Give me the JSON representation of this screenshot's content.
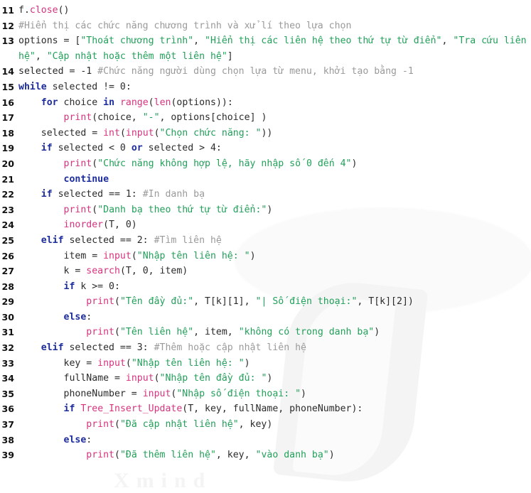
{
  "listing": {
    "language": "python",
    "first_line_number": 11,
    "last_line_number": 39,
    "colors": {
      "background": "#ffffff",
      "keyword": "#1c2c9c",
      "function": "#d6337f",
      "string": "#22a05a",
      "comment": "#9a9a9a",
      "plain": "#2b2b2b",
      "line_number": "#111111",
      "watermark": "#f2f2f2"
    },
    "lines": [
      {
        "number": "11",
        "tokens": [
          {
            "t": "plain",
            "v": "f."
          },
          {
            "t": "fn",
            "v": "close"
          },
          {
            "t": "plain",
            "v": "()"
          }
        ]
      },
      {
        "number": "12",
        "tokens": [
          {
            "t": "com",
            "v": "#Hiển thị các chức năng chương trình và xử lí theo lựa chọn"
          }
        ]
      },
      {
        "number": "13",
        "tokens": [
          {
            "t": "plain",
            "v": "options = ["
          },
          {
            "t": "str",
            "v": "\"Thoát chương trình\""
          },
          {
            "t": "plain",
            "v": ", "
          },
          {
            "t": "str",
            "v": "\"Hiển thị các liên hệ theo thứ tự từ điển\""
          },
          {
            "t": "plain",
            "v": ", "
          },
          {
            "t": "str",
            "v": "\"Tra cứu liên hệ\""
          },
          {
            "t": "plain",
            "v": ", "
          },
          {
            "t": "str",
            "v": "\"Cập nhật hoặc thêm một liên hệ\""
          },
          {
            "t": "plain",
            "v": "]"
          }
        ]
      },
      {
        "number": "14",
        "tokens": [
          {
            "t": "plain",
            "v": "selected = -1 "
          },
          {
            "t": "com",
            "v": "#Chức năng người dùng chọn lựa từ menu, khởi tạo bằng -1"
          }
        ]
      },
      {
        "number": "15",
        "tokens": [
          {
            "t": "kw",
            "v": "while"
          },
          {
            "t": "plain",
            "v": " selected != 0:"
          }
        ]
      },
      {
        "number": "16",
        "tokens": [
          {
            "t": "plain",
            "v": "    "
          },
          {
            "t": "kw",
            "v": "for"
          },
          {
            "t": "plain",
            "v": " choice "
          },
          {
            "t": "kw",
            "v": "in"
          },
          {
            "t": "plain",
            "v": " "
          },
          {
            "t": "fn",
            "v": "range"
          },
          {
            "t": "plain",
            "v": "("
          },
          {
            "t": "fn",
            "v": "len"
          },
          {
            "t": "plain",
            "v": "(options)):"
          }
        ]
      },
      {
        "number": "17",
        "tokens": [
          {
            "t": "plain",
            "v": "        "
          },
          {
            "t": "fn",
            "v": "print"
          },
          {
            "t": "plain",
            "v": "(choice, "
          },
          {
            "t": "str",
            "v": "\"-\""
          },
          {
            "t": "plain",
            "v": ", options[choice] )"
          }
        ]
      },
      {
        "number": "18",
        "tokens": [
          {
            "t": "plain",
            "v": "    selected = "
          },
          {
            "t": "fn",
            "v": "int"
          },
          {
            "t": "plain",
            "v": "("
          },
          {
            "t": "fn",
            "v": "input"
          },
          {
            "t": "plain",
            "v": "("
          },
          {
            "t": "str",
            "v": "\"Chọn chức năng: \""
          },
          {
            "t": "plain",
            "v": "))"
          }
        ]
      },
      {
        "number": "19",
        "tokens": [
          {
            "t": "plain",
            "v": "    "
          },
          {
            "t": "kw",
            "v": "if"
          },
          {
            "t": "plain",
            "v": " selected < 0 "
          },
          {
            "t": "kw",
            "v": "or"
          },
          {
            "t": "plain",
            "v": " selected > 4:"
          }
        ]
      },
      {
        "number": "20",
        "tokens": [
          {
            "t": "plain",
            "v": "        "
          },
          {
            "t": "fn",
            "v": "print"
          },
          {
            "t": "plain",
            "v": "("
          },
          {
            "t": "str",
            "v": "\"Chức năng không hợp lệ, hãy nhập số 0 đến 4\""
          },
          {
            "t": "plain",
            "v": ")"
          }
        ]
      },
      {
        "number": "21",
        "tokens": [
          {
            "t": "plain",
            "v": "        "
          },
          {
            "t": "kw",
            "v": "continue"
          }
        ]
      },
      {
        "number": "22",
        "tokens": [
          {
            "t": "plain",
            "v": "    "
          },
          {
            "t": "kw",
            "v": "if"
          },
          {
            "t": "plain",
            "v": " selected == 1: "
          },
          {
            "t": "com",
            "v": "#In danh bạ"
          }
        ]
      },
      {
        "number": "23",
        "tokens": [
          {
            "t": "plain",
            "v": "        "
          },
          {
            "t": "fn",
            "v": "print"
          },
          {
            "t": "plain",
            "v": "("
          },
          {
            "t": "str",
            "v": "\"Danh bạ theo thứ tự từ điển:\""
          },
          {
            "t": "plain",
            "v": ")"
          }
        ]
      },
      {
        "number": "24",
        "tokens": [
          {
            "t": "plain",
            "v": "        "
          },
          {
            "t": "fn",
            "v": "inorder"
          },
          {
            "t": "plain",
            "v": "(T, 0)"
          }
        ]
      },
      {
        "number": "25",
        "tokens": [
          {
            "t": "plain",
            "v": "    "
          },
          {
            "t": "kw",
            "v": "elif"
          },
          {
            "t": "plain",
            "v": " selected == 2: "
          },
          {
            "t": "com",
            "v": "#Tìm liên hệ"
          }
        ]
      },
      {
        "number": "26",
        "tokens": [
          {
            "t": "plain",
            "v": "        item = "
          },
          {
            "t": "fn",
            "v": "input"
          },
          {
            "t": "plain",
            "v": "("
          },
          {
            "t": "str",
            "v": "\"Nhập tên liên hệ: \""
          },
          {
            "t": "plain",
            "v": ")"
          }
        ]
      },
      {
        "number": "27",
        "tokens": [
          {
            "t": "plain",
            "v": "        k = "
          },
          {
            "t": "fn",
            "v": "search"
          },
          {
            "t": "plain",
            "v": "(T, 0, item)"
          }
        ]
      },
      {
        "number": "28",
        "tokens": [
          {
            "t": "plain",
            "v": "        "
          },
          {
            "t": "kw",
            "v": "if"
          },
          {
            "t": "plain",
            "v": " k >= 0:"
          }
        ]
      },
      {
        "number": "29",
        "tokens": [
          {
            "t": "plain",
            "v": "            "
          },
          {
            "t": "fn",
            "v": "print"
          },
          {
            "t": "plain",
            "v": "("
          },
          {
            "t": "str",
            "v": "\"Tên đầy đủ:\""
          },
          {
            "t": "plain",
            "v": ", T[k][1], "
          },
          {
            "t": "str",
            "v": "\"| Số điện thoại:\""
          },
          {
            "t": "plain",
            "v": ", T[k][2])"
          }
        ]
      },
      {
        "number": "30",
        "tokens": [
          {
            "t": "plain",
            "v": "        "
          },
          {
            "t": "kw",
            "v": "else"
          },
          {
            "t": "plain",
            "v": ":"
          }
        ]
      },
      {
        "number": "31",
        "tokens": [
          {
            "t": "plain",
            "v": "            "
          },
          {
            "t": "fn",
            "v": "print"
          },
          {
            "t": "plain",
            "v": "("
          },
          {
            "t": "str",
            "v": "\"Tên liên hệ\""
          },
          {
            "t": "plain",
            "v": ", item, "
          },
          {
            "t": "str",
            "v": "\"không có trong danh bạ\""
          },
          {
            "t": "plain",
            "v": ")"
          }
        ]
      },
      {
        "number": "32",
        "tokens": [
          {
            "t": "plain",
            "v": "    "
          },
          {
            "t": "kw",
            "v": "elif"
          },
          {
            "t": "plain",
            "v": " selected == 3: "
          },
          {
            "t": "com",
            "v": "#Thêm hoặc cập nhật liên hệ"
          }
        ]
      },
      {
        "number": "33",
        "tokens": [
          {
            "t": "plain",
            "v": "        key = "
          },
          {
            "t": "fn",
            "v": "input"
          },
          {
            "t": "plain",
            "v": "("
          },
          {
            "t": "str",
            "v": "\"Nhập tên liên hệ: \""
          },
          {
            "t": "plain",
            "v": ")"
          }
        ]
      },
      {
        "number": "34",
        "tokens": [
          {
            "t": "plain",
            "v": "        fullName = "
          },
          {
            "t": "fn",
            "v": "input"
          },
          {
            "t": "plain",
            "v": "("
          },
          {
            "t": "str",
            "v": "\"Nhập tên đầy đủ: \""
          },
          {
            "t": "plain",
            "v": ")"
          }
        ]
      },
      {
        "number": "35",
        "tokens": [
          {
            "t": "plain",
            "v": "        phoneNumber = "
          },
          {
            "t": "fn",
            "v": "input"
          },
          {
            "t": "plain",
            "v": "("
          },
          {
            "t": "str",
            "v": "\"Nhập số điện thoại: \""
          },
          {
            "t": "plain",
            "v": ")"
          }
        ]
      },
      {
        "number": "36",
        "tokens": [
          {
            "t": "plain",
            "v": "        "
          },
          {
            "t": "kw",
            "v": "if"
          },
          {
            "t": "plain",
            "v": " "
          },
          {
            "t": "fn",
            "v": "Tree_Insert_Update"
          },
          {
            "t": "plain",
            "v": "(T, key, fullName, phoneNumber):"
          }
        ]
      },
      {
        "number": "37",
        "tokens": [
          {
            "t": "plain",
            "v": "            "
          },
          {
            "t": "fn",
            "v": "print"
          },
          {
            "t": "plain",
            "v": "("
          },
          {
            "t": "str",
            "v": "\"Đã cập nhật liên hệ\""
          },
          {
            "t": "plain",
            "v": ", key)"
          }
        ]
      },
      {
        "number": "38",
        "tokens": [
          {
            "t": "plain",
            "v": "        "
          },
          {
            "t": "kw",
            "v": "else"
          },
          {
            "t": "plain",
            "v": ":"
          }
        ]
      },
      {
        "number": "39",
        "tokens": [
          {
            "t": "plain",
            "v": "            "
          },
          {
            "t": "fn",
            "v": "print"
          },
          {
            "t": "plain",
            "v": "("
          },
          {
            "t": "str",
            "v": "\"Đã thêm liên hệ\""
          },
          {
            "t": "plain",
            "v": ", key, "
          },
          {
            "t": "str",
            "v": "\"vào danh bạ\""
          },
          {
            "t": "plain",
            "v": ")"
          }
        ]
      }
    ]
  },
  "watermark": {
    "text": "Xmind"
  }
}
